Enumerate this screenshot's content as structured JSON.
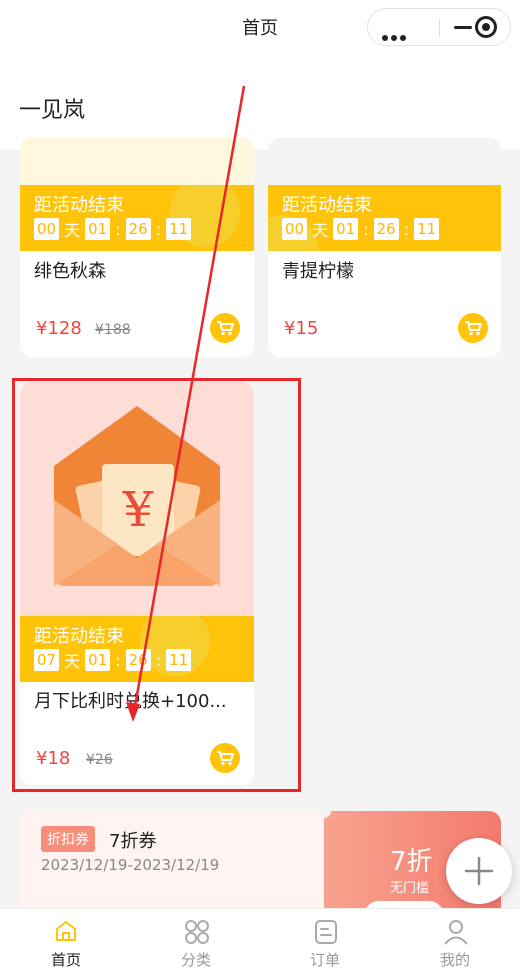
{
  "nav": {
    "title": "首页"
  },
  "shop": {
    "name": "一见岚"
  },
  "products": [
    {
      "banner_title": "距活动结束",
      "countdown": {
        "days": "00",
        "day_unit": "天",
        "hours": "01",
        "minutes": "26",
        "seconds": "11"
      },
      "name": "绯色秋森",
      "price": "¥128",
      "original_price": "¥188"
    },
    {
      "banner_title": "距活动结束",
      "countdown": {
        "days": "00",
        "day_unit": "天",
        "hours": "01",
        "minutes": "26",
        "seconds": "11"
      },
      "name": "青提柠檬",
      "price": "¥15",
      "original_price": ""
    },
    {
      "banner_title": "距活动结束",
      "countdown": {
        "days": "07",
        "day_unit": "天",
        "hours": "01",
        "minutes": "26",
        "seconds": "11"
      },
      "name": "月下比利时兑换+100...",
      "price": "¥18",
      "original_price": "¥26",
      "image_icon": "red-envelope-icon"
    }
  ],
  "coupon": {
    "tag": "折扣券",
    "name": "7折券",
    "date_range": "2023/12/19-2023/12/19",
    "discount": "7折",
    "threshold": "无门槛"
  },
  "tabbar": [
    {
      "label": "首页",
      "icon": "home-icon",
      "active": true
    },
    {
      "label": "分类",
      "icon": "category-icon",
      "active": false
    },
    {
      "label": "订单",
      "icon": "order-icon",
      "active": false
    },
    {
      "label": "我的",
      "icon": "user-icon",
      "active": false
    }
  ],
  "colors": {
    "accent": "#ffc409",
    "price": "#f0453e",
    "highlight": "#e8262b",
    "coupon": "#f47a6d"
  }
}
